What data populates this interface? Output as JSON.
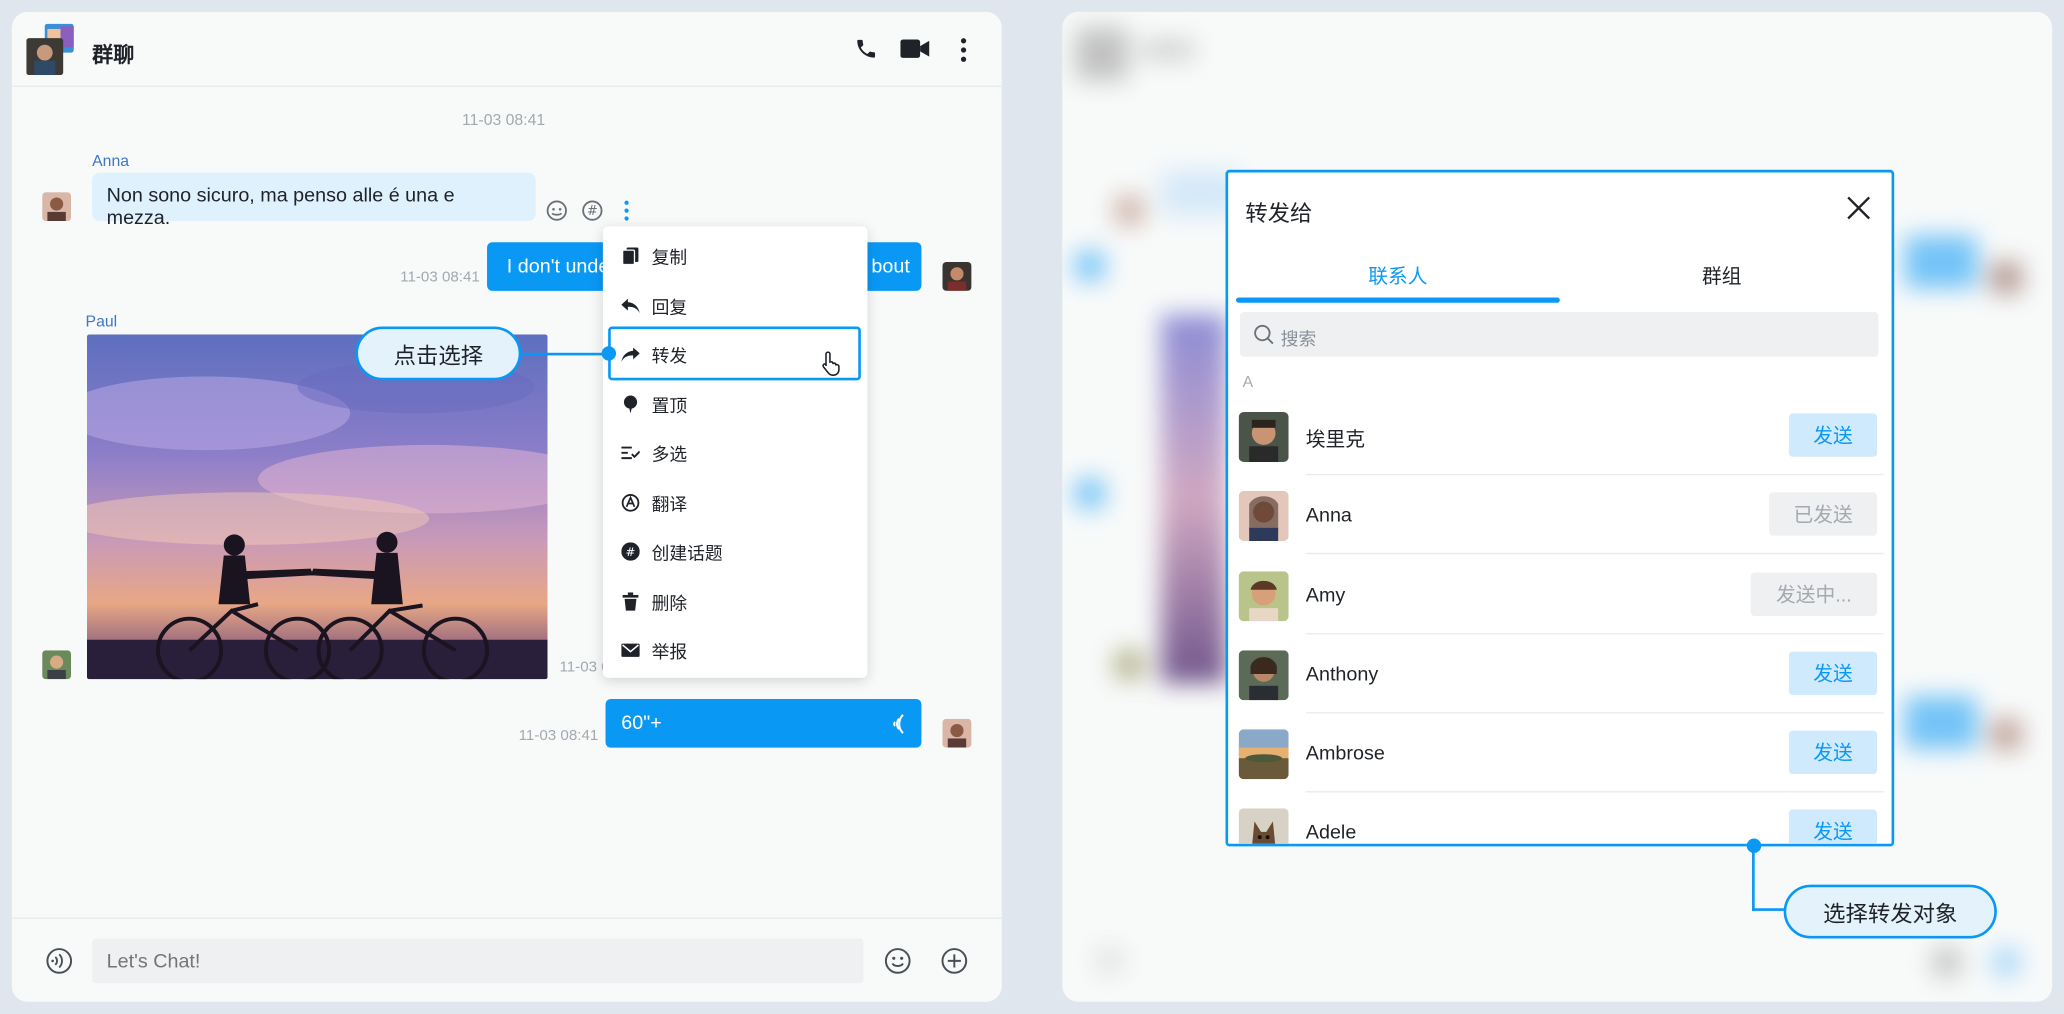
{
  "left": {
    "header": {
      "title": "群聊"
    },
    "timestamp_top": "11-03 08:41",
    "messages": [
      {
        "sender": "Anna",
        "text": "Non sono sicuro, ma penso alle é una e mezza."
      },
      {
        "time": "11-03 08:41",
        "text_left": "I don't unde",
        "text_right": "bout"
      },
      {
        "sender": "Paul",
        "time": "11-03 0"
      },
      {
        "time": "11-03 08:41",
        "text": "60\"+"
      }
    ],
    "context_menu": [
      {
        "label": "复制",
        "icon": "copy-icon"
      },
      {
        "label": "回复",
        "icon": "reply-icon"
      },
      {
        "label": "转发",
        "icon": "forward-icon"
      },
      {
        "label": "置顶",
        "icon": "pin-icon"
      },
      {
        "label": "多选",
        "icon": "multi-select-icon"
      },
      {
        "label": "翻译",
        "icon": "translate-icon"
      },
      {
        "label": "创建话题",
        "icon": "topic-icon"
      },
      {
        "label": "删除",
        "icon": "trash-icon"
      },
      {
        "label": "举报",
        "icon": "mail-icon"
      }
    ],
    "callout": "点击选择",
    "input_placeholder": "Let's Chat!"
  },
  "right": {
    "modal": {
      "title": "转发给",
      "tabs": [
        "联系人",
        "群组"
      ],
      "active_tab": 0,
      "search_placeholder": "搜索",
      "section": "A",
      "contacts": [
        {
          "name": "埃里克",
          "status": "send",
          "button": "发送"
        },
        {
          "name": "Anna",
          "status": "sent",
          "button": "已发送"
        },
        {
          "name": "Amy",
          "status": "sending",
          "button": "发送中..."
        },
        {
          "name": "Anthony",
          "status": "send",
          "button": "发送"
        },
        {
          "name": "Ambrose",
          "status": "send",
          "button": "发送"
        },
        {
          "name": "Adele",
          "status": "send",
          "button": "发送"
        }
      ]
    },
    "callout": "选择转发对象"
  },
  "colors": {
    "accent": "#0a98f5",
    "bubble_in": "#dff1fc",
    "frame": "#dfe6ee"
  }
}
